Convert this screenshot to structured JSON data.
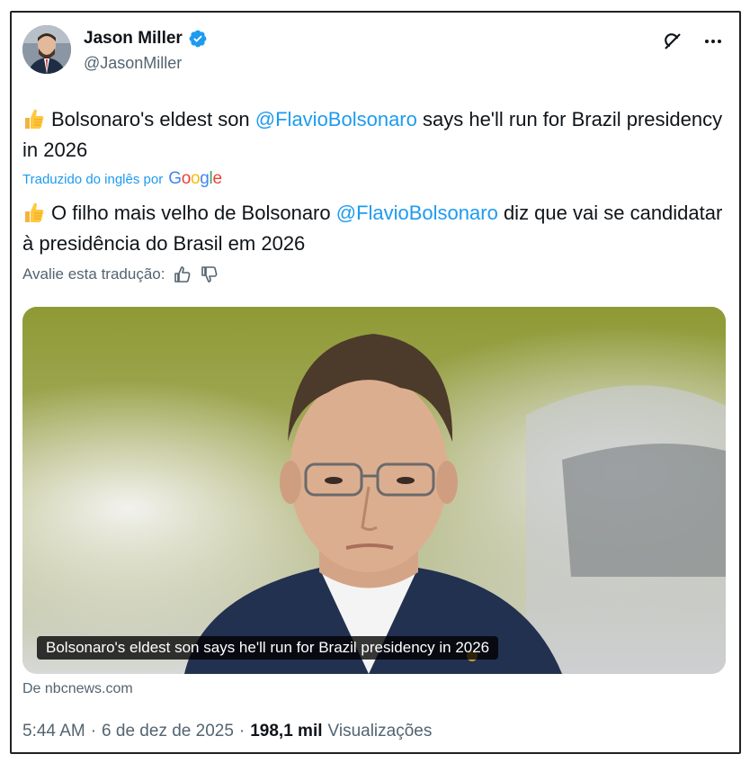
{
  "author": {
    "display_name": "Jason Miller",
    "handle": "@JasonMiller",
    "verified_icon": "verified-badge-icon",
    "verified_color": "#1d9bf0"
  },
  "icons": {
    "grok": "grok-icon",
    "more": "more-options-icon",
    "emoji": "thumbs-up-emoji"
  },
  "original_text": {
    "before_mention": "Bolsonaro's eldest son ",
    "mention": "@FlavioBolsonaro",
    "after_mention": " says he'll run for Brazil presidency in 2026"
  },
  "translation": {
    "label": "Traduzido do inglês por",
    "provider": "Google"
  },
  "translated_text": {
    "before_mention": "O filho mais velho de Bolsonaro ",
    "mention": "@FlavioBolsonaro",
    "after_mention": " diz que vai se candidatar à presidência do Brasil em 2026"
  },
  "rate": {
    "label": "Avalie esta tradução:"
  },
  "media": {
    "caption": "Bolsonaro's eldest son says he'll run for Brazil presidency in 2026",
    "source": "De nbcnews.com"
  },
  "meta": {
    "time": "5:44 AM",
    "sep1": "·",
    "date": "6 de dez de 2025",
    "sep2": "·",
    "views_count": "198,1 mil",
    "views_label": "Visualizações"
  },
  "colors": {
    "link": "#1d9bf0",
    "secondary_text": "#536471",
    "primary_text": "#0f1419"
  }
}
